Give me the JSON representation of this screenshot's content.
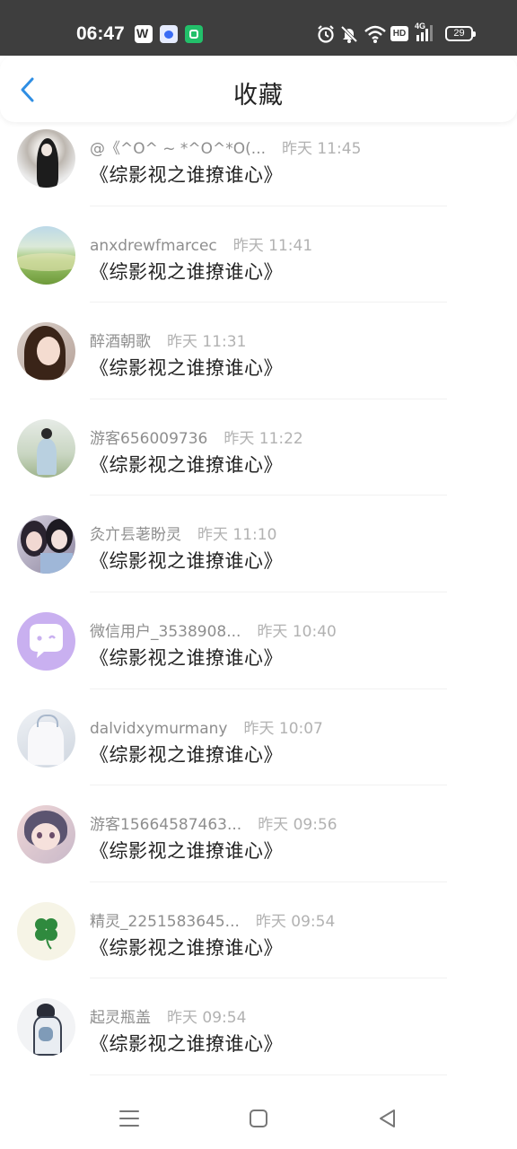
{
  "status_bar": {
    "time": "06:47",
    "battery": "29",
    "network": "4G",
    "hd_label": "HD",
    "icons": [
      "wps-icon",
      "baidu-paw-icon",
      "shopping-app-icon",
      "alarm-icon",
      "mute-icon",
      "wifi-icon",
      "hd-icon",
      "signal-icon",
      "battery-icon"
    ]
  },
  "header": {
    "title": "收藏",
    "back_icon": "chevron-left-icon",
    "accent_color": "#2f8ee3"
  },
  "items": [
    {
      "user": "@《^O^ ~ *^O^*O(...",
      "time": "昨天 11:45",
      "book": "《综影视之谁撩谁心》"
    },
    {
      "user": "anxdrewfmarcec",
      "time": "昨天 11:41",
      "book": "《综影视之谁撩谁心》"
    },
    {
      "user": "醉酒朝歌",
      "time": "昨天 11:31",
      "book": "《综影视之谁撩谁心》"
    },
    {
      "user": "游客656009736",
      "time": "昨天 11:22",
      "book": "《综影视之谁撩谁心》"
    },
    {
      "user": "灸亣镸荖盼灵",
      "time": "昨天 11:10",
      "book": "《综影视之谁撩谁心》"
    },
    {
      "user": "微信用户_3538908...",
      "time": "昨天 10:40",
      "book": "《综影视之谁撩谁心》"
    },
    {
      "user": "dalvidxymurmany",
      "time": "昨天 10:07",
      "book": "《综影视之谁撩谁心》"
    },
    {
      "user": "游客15664587463...",
      "time": "昨天 09:56",
      "book": "《综影视之谁撩谁心》"
    },
    {
      "user": "精灵_2251583645...",
      "time": "昨天 09:54",
      "book": "《综影视之谁撩谁心》"
    },
    {
      "user": "起灵瓶盖",
      "time": "昨天 09:54",
      "book": "《综影视之谁撩谁心》"
    }
  ],
  "nav_bar": {
    "icons": [
      "menu-icon",
      "home-square-icon",
      "back-triangle-icon"
    ]
  }
}
